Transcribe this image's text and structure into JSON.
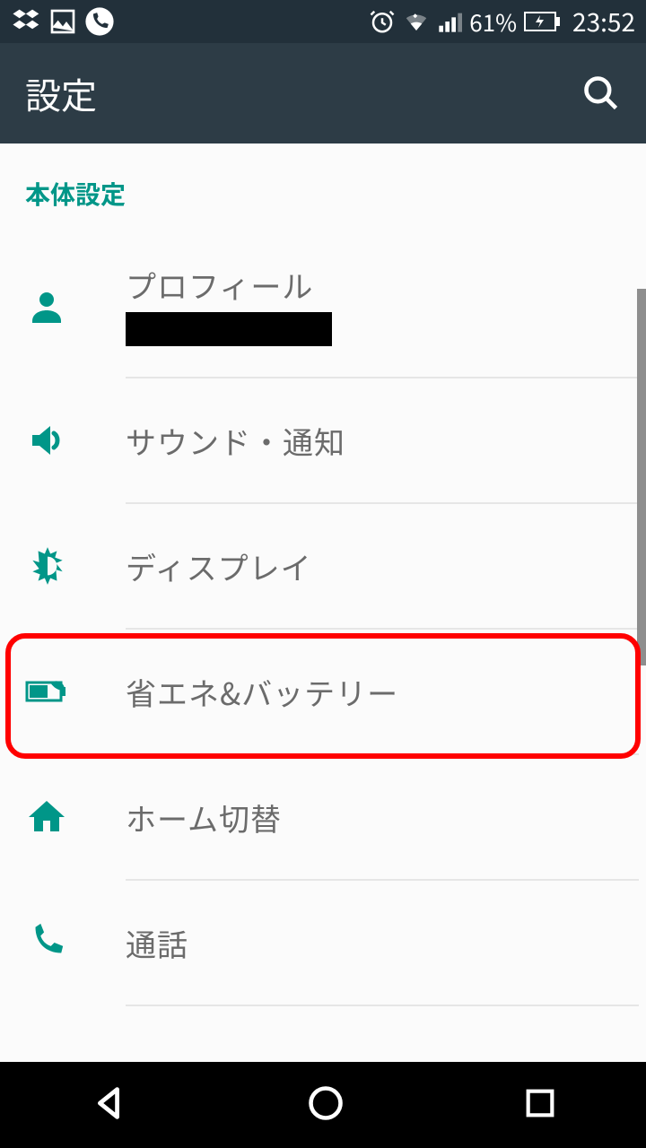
{
  "status": {
    "battery_pct": "61%",
    "time": "23:52"
  },
  "app_bar": {
    "title": "設定"
  },
  "section": {
    "header": "本体設定"
  },
  "items": {
    "profile": {
      "title": "プロフィール"
    },
    "sound": {
      "title": "サウンド・通知"
    },
    "display": {
      "title": "ディスプレイ"
    },
    "battery": {
      "title": "省エネ&バッテリー"
    },
    "home": {
      "title": "ホーム切替"
    },
    "call": {
      "title": "通話"
    }
  },
  "colors": {
    "accent": "#009688",
    "highlight": "#ff0000"
  }
}
